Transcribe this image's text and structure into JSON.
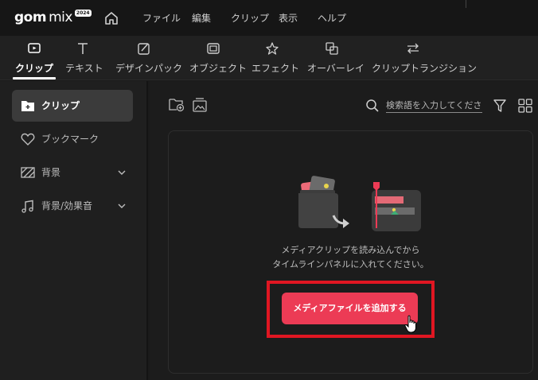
{
  "app": {
    "logo_text": "gom",
    "logo_suffix": "mix",
    "logo_badge": "2024"
  },
  "menu": {
    "items": [
      "ファイル",
      "編集",
      "クリップ",
      "表示",
      "ヘルプ"
    ]
  },
  "toolbar": {
    "tabs": [
      {
        "label": "クリップ",
        "icon": "clip-icon",
        "active": true
      },
      {
        "label": "テキスト",
        "icon": "text-icon"
      },
      {
        "label": "デザインパック",
        "icon": "design-pack-icon"
      },
      {
        "label": "オブジェクト",
        "icon": "object-icon"
      },
      {
        "label": "エフェクト",
        "icon": "effect-icon"
      },
      {
        "label": "オーバーレイ",
        "icon": "overlay-icon"
      },
      {
        "label": "クリップトランジション",
        "icon": "transition-icon"
      }
    ]
  },
  "sidebar": {
    "items": [
      {
        "label": "クリップ",
        "icon": "clip-add-icon",
        "active": true
      },
      {
        "label": "ブックマーク",
        "icon": "heart-icon"
      },
      {
        "label": "背景",
        "icon": "background-pattern-icon",
        "expandable": true
      },
      {
        "label": "背景/効果音",
        "icon": "music-note-icon",
        "expandable": true
      }
    ]
  },
  "main": {
    "search_placeholder": "検索語を入力してください。",
    "hint_line1": "メディアクリップを読み込んでから",
    "hint_line2": "タイムラインパネルに入れてください。",
    "add_button_label": "メディアファイルを追加する"
  },
  "colors": {
    "accent": "#ec3b55",
    "highlight": "#e01622",
    "background": "#1c1c1c"
  }
}
